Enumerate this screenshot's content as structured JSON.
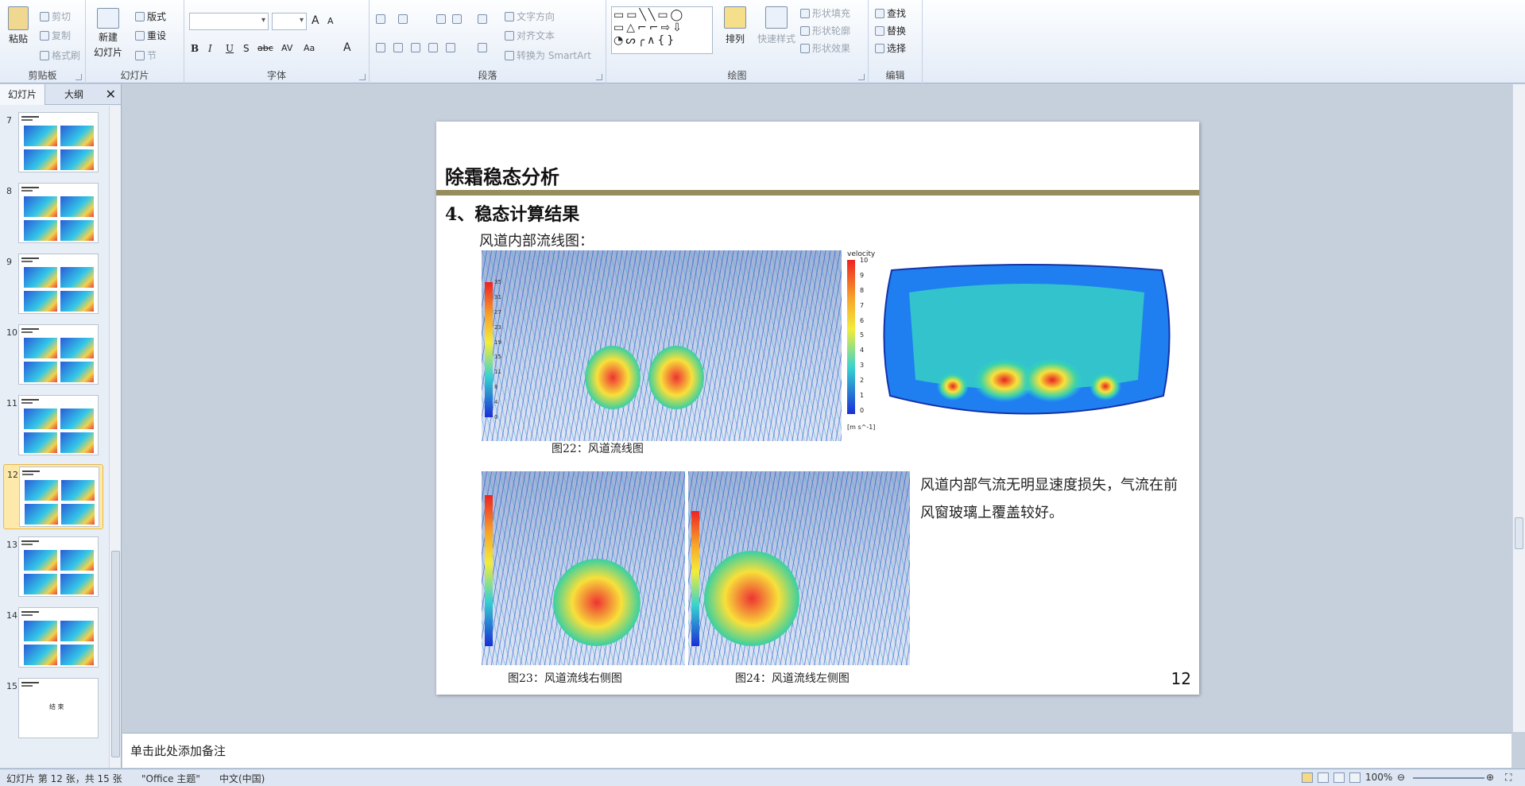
{
  "ribbon": {
    "clipboard": {
      "label": "剪贴板",
      "paste": "粘贴",
      "cut": "剪切",
      "copy": "复制",
      "format_painter": "格式刷"
    },
    "slides": {
      "label": "幻灯片",
      "new_slide_line1": "新建",
      "new_slide_line2": "幻灯片",
      "layout": "版式",
      "reset": "重设",
      "section": "节"
    },
    "font": {
      "label": "字体",
      "bold": "B",
      "italic": "I",
      "underline": "U",
      "shadow": "S",
      "strike": "abc",
      "spacing": "AV",
      "case": "Aa",
      "color": "A",
      "grow": "A",
      "shrink": "A"
    },
    "paragraph": {
      "label": "段落",
      "text_direction": "文字方向",
      "align_text": "对齐文本",
      "convert_smartart": "转换为 SmartArt"
    },
    "drawing": {
      "label": "绘图",
      "arrange": "排列",
      "quick_styles": "快速样式",
      "shape_fill": "形状填充",
      "shape_outline": "形状轮廓",
      "shape_effects": "形状效果"
    },
    "editing": {
      "label": "编辑",
      "find": "查找",
      "replace": "替换",
      "select": "选择"
    }
  },
  "sidebar": {
    "tab_slides": "幻灯片",
    "tab_outline": "大纲",
    "thumbnails": [
      {
        "num": "7"
      },
      {
        "num": "8"
      },
      {
        "num": "9"
      },
      {
        "num": "10"
      },
      {
        "num": "11"
      },
      {
        "num": "12",
        "selected": true
      },
      {
        "num": "13"
      },
      {
        "num": "14"
      },
      {
        "num": "15",
        "text": "结 束"
      }
    ]
  },
  "slide": {
    "title": "除霜稳态分析",
    "heading": "4、稳态计算结果",
    "subtitle": "风道内部流线图：",
    "legend_title": "velocity",
    "legend_unit": "[m s^-1]",
    "legend_ticks_right": [
      "10",
      "9",
      "8",
      "7",
      "6",
      "5",
      "4",
      "3",
      "2",
      "1",
      "0"
    ],
    "legend_ticks_left": [
      "35",
      "31",
      "27",
      "23",
      "19",
      "15",
      "11",
      "8",
      "4",
      "0"
    ],
    "caption22": "图22：风道流线图",
    "caption23": "图23：风道流线右侧图",
    "caption24": "图24：风道流线左侧图",
    "paragraph": "风道内部气流无明显速度损失，气流在前风窗玻璃上覆盖较好。",
    "page_number": "12"
  },
  "notes": {
    "placeholder": "单击此处添加备注"
  },
  "status": {
    "slide_info": "幻灯片 第 12 张，共 15 张",
    "theme": "\"Office 主题\"",
    "language": "中文(中国)",
    "zoom": "100%"
  }
}
